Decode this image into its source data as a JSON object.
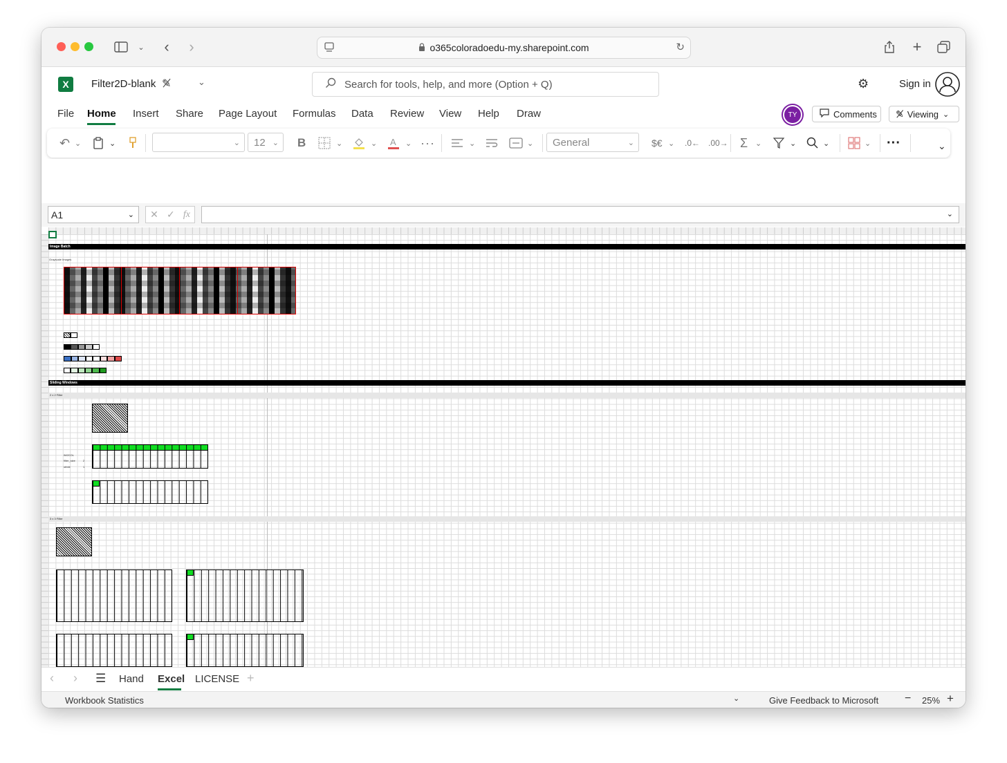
{
  "browser": {
    "url": "o365coloradoedu-my.sharepoint.com"
  },
  "excel": {
    "file_name": "Filter2D-blank",
    "search_placeholder": "Search for tools, help, and more (Option + Q)",
    "sign_in": "Sign in",
    "avatar_initials": "TY",
    "comments_label": "Comments",
    "viewing_label": "Viewing",
    "menu_tabs": [
      "File",
      "Home",
      "Insert",
      "Share",
      "Page Layout",
      "Formulas",
      "Data",
      "Review",
      "View",
      "Help",
      "Draw"
    ],
    "active_tab": "Home"
  },
  "ribbon": {
    "font_size": "12",
    "number_format": "General",
    "currency_symbol": "$€"
  },
  "formula_bar": {
    "cell_ref": "A1",
    "fx": "fx"
  },
  "sheet_content": {
    "section1": "Image Batch",
    "grayscale_images": "Grayscale Images",
    "section2": "Sliding Windows",
    "filter_2x2": "2 x 2 Filter",
    "filter_3x3": "3 x 3 Filter",
    "im2col": "IM2COL",
    "filter_size": "filter_size",
    "filter_size_val": "2",
    "stride": "stride",
    "stride_val": "1"
  },
  "sheets": {
    "tabs": [
      "Hand",
      "Excel",
      "LICENSE"
    ],
    "active": "Excel"
  },
  "status_bar": {
    "left": "Workbook Statistics",
    "feedback": "Give Feedback to Microsoft",
    "zoom": "25%"
  },
  "colors": {
    "excel_green": "#107c41",
    "avatar_purple": "#7b1fa2",
    "highlight_green": "#11dd22",
    "border_red": "#dd0000"
  }
}
